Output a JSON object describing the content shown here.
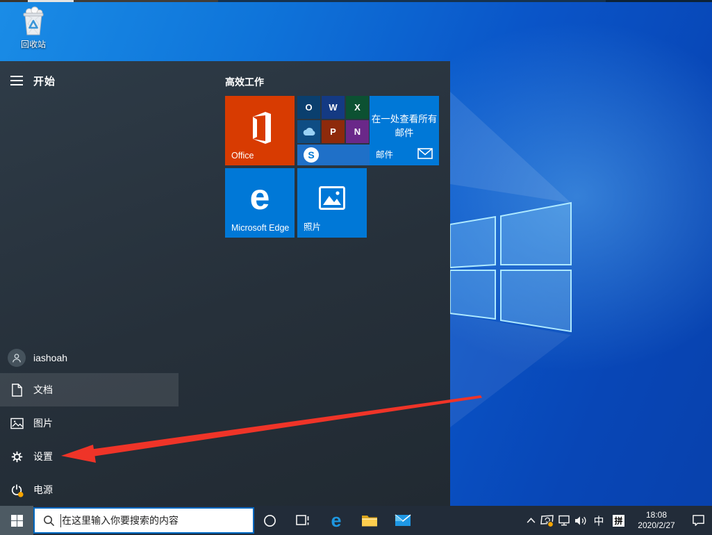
{
  "desktop": {
    "recycle_bin_label": "回收站"
  },
  "start_menu": {
    "title": "开始",
    "tiles_header": "高效工作",
    "tiles": {
      "office": {
        "label": "Office"
      },
      "folder": {
        "apps": [
          {
            "name": "Outlook",
            "letter": "O"
          },
          {
            "name": "Word",
            "letter": "W"
          },
          {
            "name": "Excel",
            "letter": "X"
          },
          {
            "name": "OneDrive",
            "letter": ""
          },
          {
            "name": "PowerPoint",
            "letter": "P"
          },
          {
            "name": "OneNote",
            "letter": "N"
          },
          {
            "name": "Skype",
            "letter": "S"
          }
        ]
      },
      "mail": {
        "line1": "在一处查看所有",
        "line2": "邮件",
        "label": "邮件"
      },
      "edge": {
        "logo_letter": "e",
        "label": "Microsoft Edge"
      },
      "photos": {
        "label": "照片"
      }
    },
    "sidebar": {
      "user": {
        "label": "iashoah"
      },
      "items": [
        {
          "label": "文档"
        },
        {
          "label": "图片"
        },
        {
          "label": "设置"
        },
        {
          "label": "电源"
        }
      ]
    }
  },
  "taskbar": {
    "search_placeholder": "在这里输入你要搜索的内容",
    "tray": {
      "ime_lang": "中",
      "ime_mode": "拼",
      "time": "18:08",
      "date": "2020/2/27"
    }
  },
  "colors": {
    "accent": "#0078d7",
    "office_tile": "#d83b01",
    "menu_bg": "#27323c",
    "taskbar_bg": "#222c39",
    "search_border": "#0067c0",
    "arrow_red": "#ef3428",
    "update_dot_orange": "#f7a500"
  }
}
